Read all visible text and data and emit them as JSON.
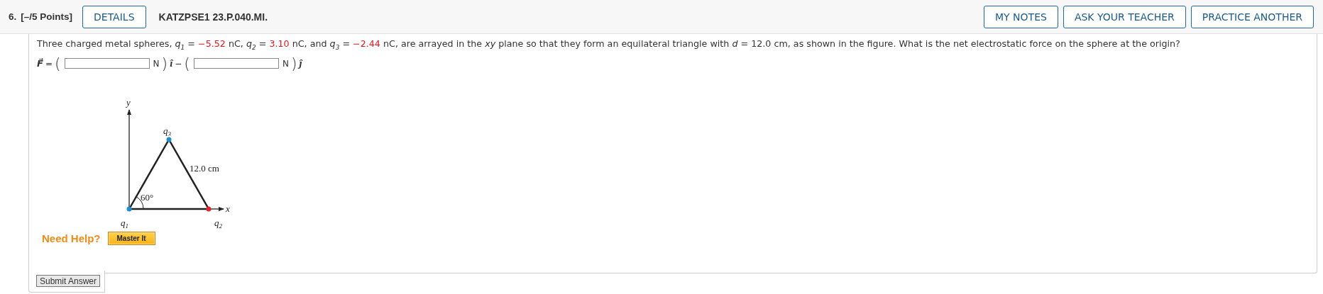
{
  "header": {
    "number": "6.",
    "points": "[–/5 Points]",
    "details_button": "DETAILS",
    "code": "KATZPSE1 23.P.040.MI.",
    "buttons": [
      "MY NOTES",
      "ASK YOUR TEACHER",
      "PRACTICE ANOTHER"
    ]
  },
  "question": [
    {
      "kind": "text",
      "text": "Three charged metal spheres, "
    },
    {
      "kind": "math",
      "text": "q$_{1}$"
    },
    {
      "kind": "text",
      "text": " = "
    },
    {
      "kind": "given",
      "text": "−5.52"
    },
    {
      "kind": "text",
      "text": " nC,  "
    },
    {
      "kind": "math",
      "text": "q$_{2}$"
    },
    {
      "kind": "text",
      "text": " = "
    },
    {
      "kind": "given",
      "text": "3.10"
    },
    {
      "kind": "text",
      "text": " nC,  and  "
    },
    {
      "kind": "math",
      "text": "q$_{3}$"
    },
    {
      "kind": "text",
      "text": " = "
    },
    {
      "kind": "given",
      "text": "−2.44"
    },
    {
      "kind": "text",
      "text": " nC,  are arrayed in the "
    },
    {
      "kind": "math",
      "text": "xy"
    },
    {
      "kind": "text",
      "text": " plane so that they form an equilateral triangle with  "
    },
    {
      "kind": "math",
      "text": "d"
    },
    {
      "kind": "text",
      "text": " = 12.0 cm,  as shown in the figure. What is the net electrostatic force on the sphere at the origin?"
    }
  ],
  "answer": [
    {
      "kind": "symbol",
      "text": "F⃗"
    },
    {
      "kind": "text",
      "text": "="
    },
    {
      "kind": "paren",
      "text": "("
    },
    {
      "kind": "field"
    },
    {
      "kind": "unit",
      "text": "N"
    },
    {
      "kind": "paren",
      "text": ")"
    },
    {
      "kind": "vector",
      "text": "î"
    },
    {
      "kind": "text",
      "text": "−"
    },
    {
      "kind": "paren",
      "text": "("
    },
    {
      "kind": "field"
    },
    {
      "kind": "unit",
      "text": "N"
    },
    {
      "kind": "paren",
      "text": ")"
    },
    {
      "kind": "vector",
      "text": "ĵ"
    }
  ],
  "figure": {
    "y_axis": "y",
    "x_axis": "x",
    "side": "12.0 cm",
    "angle": "60°",
    "charges": [
      {
        "label": "q$_{1}$",
        "color": "#1f8ecf"
      },
      {
        "label": "q$_{2}$",
        "color": "#e0252d"
      },
      {
        "label": "q$_{3}$",
        "color": "#1f8ecf"
      }
    ]
  },
  "help": {
    "label": "Need Help?",
    "button": "Master It"
  },
  "submit": "Submit Answer"
}
